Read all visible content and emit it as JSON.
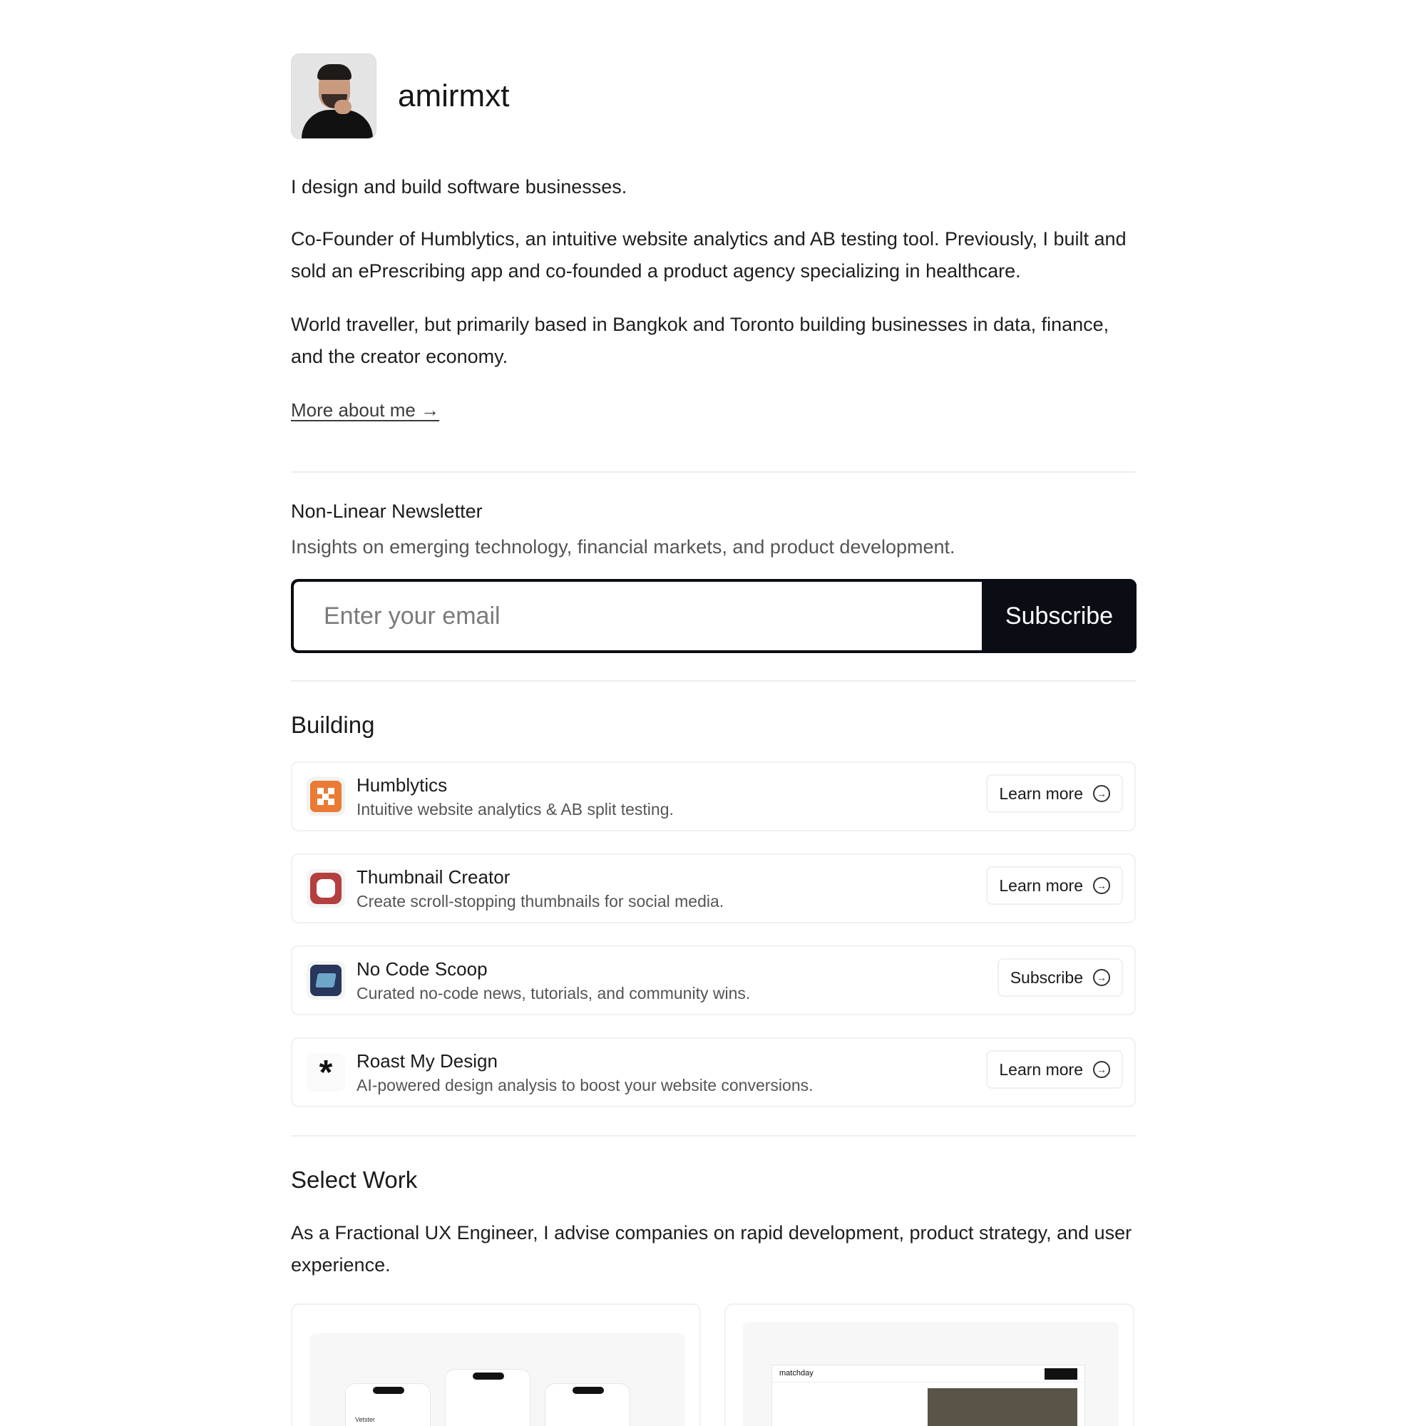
{
  "profile": {
    "username": "amirmxt",
    "tagline": "I design and build software businesses.",
    "bio_1": "Co-Founder of Humblytics, an intuitive website analytics and AB testing tool. Previously, I built and sold an ePrescribing app and co-founded a product agency specializing in healthcare.",
    "bio_2": "World traveller, but primarily based in Bangkok and Toronto building businesses in data, finance, and the creator economy.",
    "more_link": "More about me →"
  },
  "newsletter": {
    "title": "Non-Linear Newsletter",
    "subtitle": "Insights on emerging technology, financial markets, and product development.",
    "email_placeholder": "Enter your email",
    "button": "Subscribe"
  },
  "building": {
    "heading": "Building",
    "items": [
      {
        "name": "Humblytics",
        "description": "Intuitive website analytics & AB split testing.",
        "cta": "Learn more",
        "icon": "humblytics-logo-icon",
        "color": "#ea7b35"
      },
      {
        "name": "Thumbnail Creator",
        "description": "Create scroll-stopping thumbnails for social media.",
        "cta": "Learn more",
        "icon": "thumbnail-creator-logo-icon",
        "color": "#b3403f"
      },
      {
        "name": "No Code Scoop",
        "description": "Curated no-code news, tutorials, and community wins.",
        "cta": "Subscribe",
        "icon": "no-code-scoop-logo-icon",
        "color": "#27365a"
      },
      {
        "name": "Roast My Design",
        "description": "AI-powered design analysis to boost your website conversions.",
        "cta": "Learn more",
        "icon": "asterisk-icon",
        "glyph": "*"
      }
    ]
  },
  "select_work": {
    "heading": "Select Work",
    "description": "As a Fractional UX Engineer, I advise companies on rapid development, product strategy, and user experience.",
    "cards": [
      {
        "label": "Vetster",
        "icon": "mobile-app-screenshot"
      },
      {
        "label": "matchday",
        "icon": "website-screenshot"
      }
    ]
  }
}
